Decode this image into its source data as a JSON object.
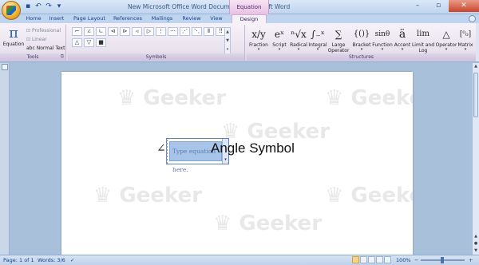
{
  "window": {
    "title": "New Microsoft Office Word Document - Microsoft Word",
    "contextual_tab_group": "Equation Tools"
  },
  "tabs": [
    {
      "label": "Home"
    },
    {
      "label": "Insert"
    },
    {
      "label": "Page Layout"
    },
    {
      "label": "References"
    },
    {
      "label": "Mailings"
    },
    {
      "label": "Review"
    },
    {
      "label": "View"
    },
    {
      "label": "Design",
      "active": true
    }
  ],
  "ribbon": {
    "tools": {
      "group_label": "Tools",
      "equation_label": "Equation",
      "professional_label": "Professional",
      "linear_label": "Linear",
      "normal_text_label": "Normal Text"
    },
    "symbols": {
      "group_label": "Symbols",
      "row1": [
        "⌐",
        "∠",
        "∟",
        "⊲",
        "⊳",
        "◃",
        "▷",
        "⋮",
        "⋯",
        "⋰",
        "⋱",
        "⫴",
        "‼"
      ],
      "row2": [
        "△",
        "▽",
        "■"
      ]
    },
    "structures": {
      "group_label": "Structures",
      "items": [
        {
          "icon": "x/y",
          "label": "Fraction"
        },
        {
          "icon": "eˣ",
          "label": "Script"
        },
        {
          "icon": "ⁿ√x",
          "label": "Radical"
        },
        {
          "icon": "∫₋ˣ",
          "label": "Integral"
        },
        {
          "icon": "∑",
          "label": "Large Operator"
        },
        {
          "icon": "{()}",
          "label": "Bracket"
        },
        {
          "icon": "sinθ",
          "label": "Function"
        },
        {
          "icon": "ä",
          "label": "Accent"
        },
        {
          "icon": "lim",
          "label": "Limit and Log"
        },
        {
          "icon": "△",
          "label": "Operator"
        },
        {
          "icon": "[⁰₀]",
          "label": "Matrix"
        }
      ]
    }
  },
  "document": {
    "angle_symbol": "∠",
    "equation_placeholder": "Type equation here.",
    "text": "Angle Symbol"
  },
  "status_bar": {
    "page": "Page: 1 of 1",
    "words": "Words: 3/6",
    "zoom": "100%"
  }
}
